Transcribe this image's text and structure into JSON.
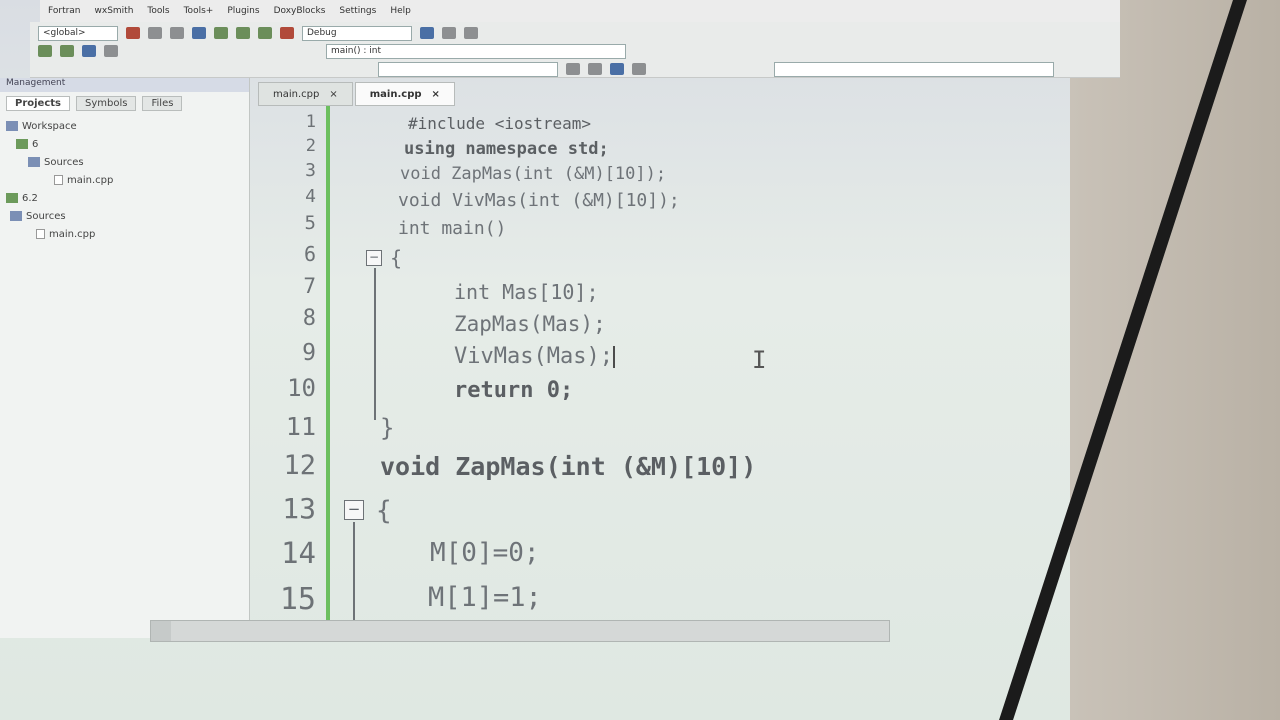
{
  "menu": [
    "Fortran",
    "wxSmith",
    "Tools",
    "Tools+",
    "Plugins",
    "DoxyBlocks",
    "Settings",
    "Help"
  ],
  "toolbar": {
    "global_combo": "<global>",
    "build_target": "Debug",
    "function_combo": "main() : int"
  },
  "sidebar": {
    "title": "Management",
    "tabs": [
      "Projects",
      "Symbols",
      "Files"
    ],
    "workspace_label": "Workspace",
    "tree": [
      {
        "label": "6",
        "type": "project"
      },
      {
        "label": "Sources",
        "type": "folder"
      },
      {
        "label": "main.cpp",
        "type": "file"
      },
      {
        "label": "6.2",
        "type": "project"
      },
      {
        "label": "Sources",
        "type": "folder"
      },
      {
        "label": "main.cpp",
        "type": "file"
      }
    ]
  },
  "editor_tabs": [
    {
      "label": "main.cpp",
      "close": "×"
    },
    {
      "label": "main.cpp",
      "close": "×"
    }
  ],
  "code_lines": [
    {
      "num": "1",
      "text": "#include <iostream>"
    },
    {
      "num": "2",
      "text": "using namespace std;"
    },
    {
      "num": "3",
      "text": "void ZapMas(int (&M)[10]);"
    },
    {
      "num": "4",
      "text": "void VivMas(int (&M)[10]);"
    },
    {
      "num": "5",
      "text": "int main()"
    },
    {
      "num": "6",
      "text": "{"
    },
    {
      "num": "7",
      "text": "int Mas[10];"
    },
    {
      "num": "8",
      "text": "ZapMas(Mas);"
    },
    {
      "num": "9",
      "text": "VivMas(Mas);"
    },
    {
      "num": "10",
      "text": "return 0;"
    },
    {
      "num": "11",
      "text": "}"
    },
    {
      "num": "12",
      "text": "void ZapMas(int (&M)[10])"
    },
    {
      "num": "13",
      "text": "{"
    },
    {
      "num": "14",
      "text": "M[0]=0;"
    },
    {
      "num": "15",
      "text": "M[1]=1;"
    }
  ],
  "fold_symbol": "−",
  "cursor_glyph": "I"
}
